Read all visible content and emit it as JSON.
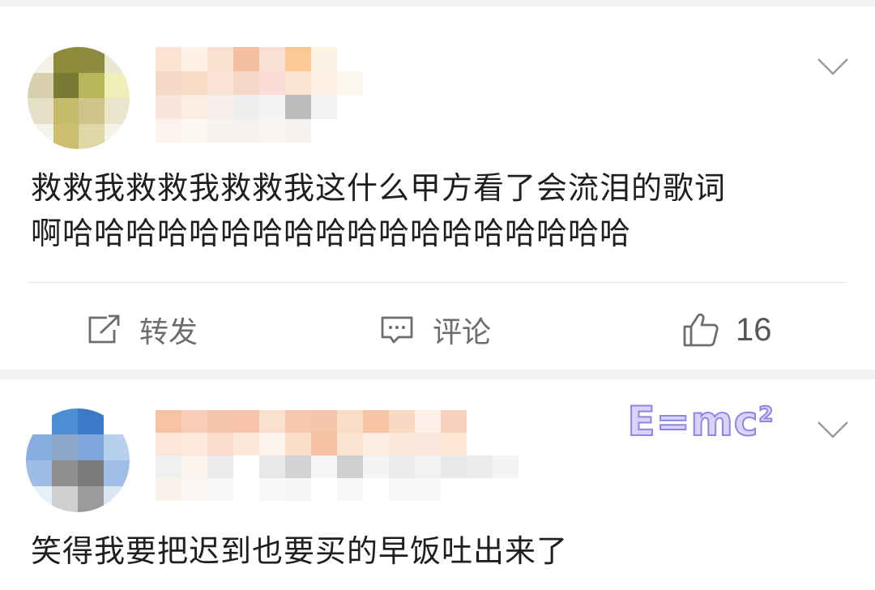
{
  "comments": [
    {
      "text_line_1": "救救我救救我救救我这什么甲方看了会流泪的歌词",
      "text_line_2": "啊哈哈哈哈哈哈哈哈哈哈哈哈哈哈哈哈哈哈",
      "actions": {
        "repost_label": "转发",
        "comment_label": "评论",
        "like_count": "16"
      }
    },
    {
      "badge": "E=mc",
      "badge_sup": "2",
      "text_line_1": "笑得我要把迟到也要买的早饭吐出来了"
    }
  ],
  "icons": [
    "repost-icon",
    "comment-icon",
    "like-icon",
    "chevron-down-icon"
  ],
  "colors": {
    "text": "#1f1f1f",
    "action_grey": "#6d6d6d",
    "divider": "#e4e4e4",
    "badge_fill": "#d9d4f7",
    "badge_stroke": "#8f86e4"
  }
}
